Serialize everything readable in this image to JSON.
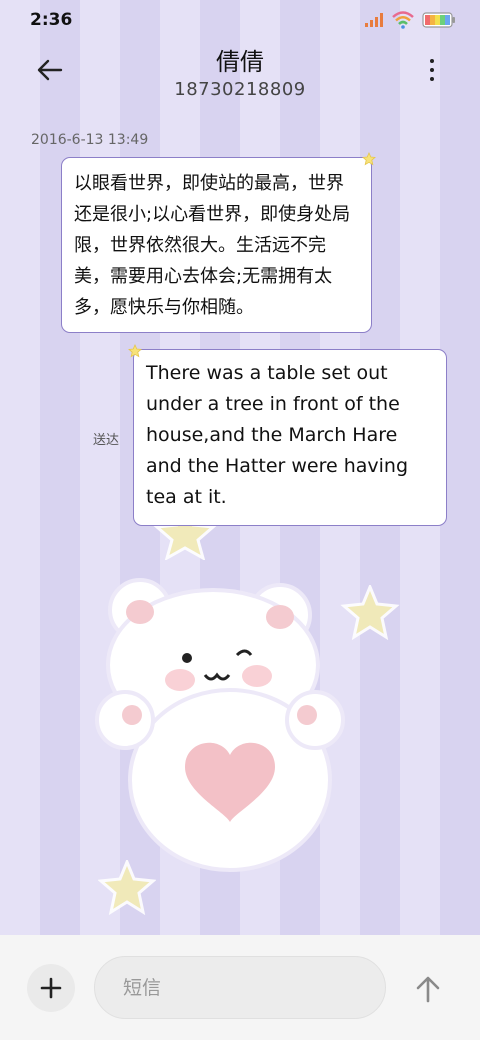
{
  "status_bar": {
    "time": "2:36",
    "icons": [
      "signal-icon",
      "wifi-icon",
      "battery-icon"
    ]
  },
  "header": {
    "contact_name": "倩倩",
    "contact_number": "18730218809",
    "back_icon": "back-arrow-icon",
    "more_icon": "more-vertical-icon"
  },
  "conversation": {
    "timestamp": "2016-6-13 13:49",
    "messages": [
      {
        "direction": "incoming",
        "text": "以眼看世界，即使站的最高，世界还是很小;以心看世界，即使身处局限，世界依然很大。生活远不完美，需要用心去体会;无需拥有太多，愿快乐与你相随。"
      },
      {
        "direction": "outgoing",
        "text": "There was a table set out under a tree in front of the house,and the March Hare and the Hatter were having tea at it.",
        "status": "送达"
      }
    ]
  },
  "composer": {
    "add_icon": "plus-icon",
    "placeholder": "短信",
    "send_icon": "send-arrow-icon"
  },
  "colors": {
    "wallpaper_light": "#e5e1f6",
    "wallpaper_dark": "#d8d3f0",
    "bubble_border": "#8c7fc8",
    "star": "#f3e9a6"
  }
}
